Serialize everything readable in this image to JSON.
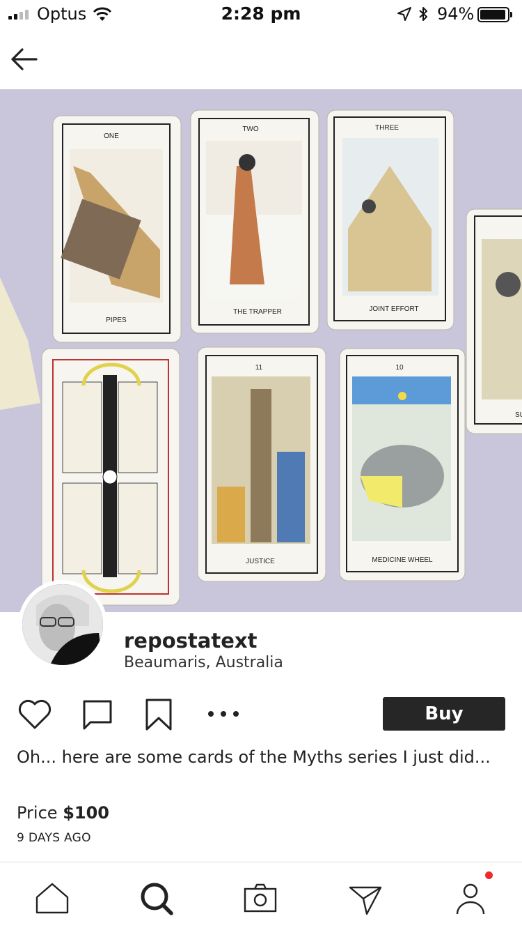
{
  "status_bar": {
    "carrier": "Optus",
    "time": "2:28 pm",
    "battery": "94%",
    "battery_level": 0.94,
    "signal_bars": 2,
    "icons": [
      "signal-icon",
      "wifi-icon",
      "location-arrow-icon",
      "bluetooth-icon",
      "battery-icon"
    ]
  },
  "nav": {
    "back_icon": "back-arrow-icon"
  },
  "post": {
    "image_description_cards": [
      "ONE",
      "TWO",
      "THREE",
      "PIPES",
      "THE TRAPPER",
      "JOINT EFFORT",
      "11",
      "10",
      "JUSTICE",
      "MEDICINE WHEEL",
      "SU"
    ],
    "username": "repostatext",
    "location": "Beaumaris, Australia",
    "buy_label": "Buy",
    "caption": "Oh... here are some cards of the Myths series I just did...",
    "price_label": "Price",
    "price_value": "$100",
    "time_ago": "9 DAYS AGO"
  },
  "actions": [
    "heart-icon",
    "comment-icon",
    "bookmark-icon",
    "more-icon"
  ],
  "tabs": [
    "home-icon",
    "search-icon",
    "camera-icon",
    "send-icon",
    "profile-icon"
  ],
  "colors": {
    "buy_background": "#262626",
    "notification_dot": "#f02a2a",
    "photo_background": "#c9c6dc"
  }
}
